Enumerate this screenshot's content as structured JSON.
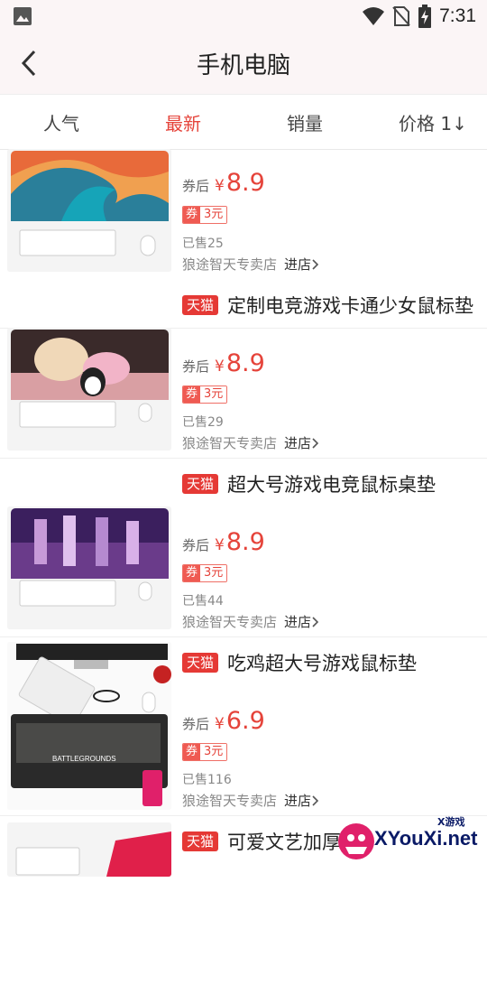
{
  "status_bar": {
    "time": "7:31"
  },
  "nav": {
    "title": "手机电脑"
  },
  "tabs": [
    {
      "label": "人气"
    },
    {
      "label": "最新"
    },
    {
      "label": "销量"
    },
    {
      "label": "价格 1↓"
    }
  ],
  "active_tab_color": "#e5433a",
  "products": [
    {
      "title": "",
      "tmall": false,
      "price_prefix": "券后",
      "currency": "¥",
      "price": "8.9",
      "coupon_tag": "券",
      "coupon_amount": "3元",
      "sold": "已售25",
      "shop": "狼途智天专卖店",
      "enter_label": "进店"
    },
    {
      "title": "定制电竞游戏卡通少女鼠标垫",
      "tmall": true,
      "tmall_label": "天猫",
      "price_prefix": "券后",
      "currency": "¥",
      "price": "8.9",
      "coupon_tag": "券",
      "coupon_amount": "3元",
      "sold": "已售29",
      "shop": "狼途智天专卖店",
      "enter_label": "进店"
    },
    {
      "title": "超大号游戏电竞鼠标桌垫",
      "tmall": true,
      "tmall_label": "天猫",
      "price_prefix": "券后",
      "currency": "¥",
      "price": "8.9",
      "coupon_tag": "券",
      "coupon_amount": "3元",
      "sold": "已售44",
      "shop": "狼途智天专卖店",
      "enter_label": "进店"
    },
    {
      "title": "吃鸡超大号游戏鼠标垫",
      "tmall": true,
      "tmall_label": "天猫",
      "price_prefix": "券后",
      "currency": "¥",
      "price": "6.9",
      "coupon_tag": "券",
      "coupon_amount": "3元",
      "sold": "已售116",
      "shop": "狼途智天专卖店",
      "enter_label": "进店"
    },
    {
      "title": "可爱文艺加厚",
      "tmall": true,
      "tmall_label": "天猫"
    }
  ],
  "thumb_captions": {
    "battlegrounds": "BATTLEGROUNDS"
  },
  "watermark": {
    "text": "XYouXi.net",
    "small": "X游戏"
  }
}
